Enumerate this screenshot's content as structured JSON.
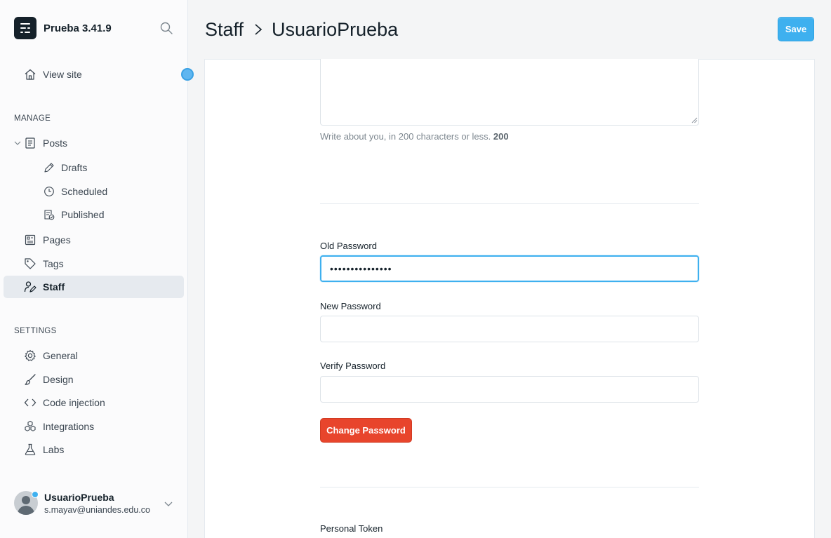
{
  "brand": {
    "title": "Prueba 3.41.9"
  },
  "sidebar": {
    "view_site": "View site",
    "manage_label": "MANAGE",
    "posts": "Posts",
    "drafts": "Drafts",
    "scheduled": "Scheduled",
    "published": "Published",
    "pages": "Pages",
    "tags": "Tags",
    "staff": "Staff",
    "settings_label": "SETTINGS",
    "general": "General",
    "design": "Design",
    "code_injection": "Code injection",
    "integrations": "Integrations",
    "labs": "Labs"
  },
  "user": {
    "name": "UsuarioPrueba",
    "email": "s.mayav@uniandes.edu.co"
  },
  "header": {
    "crumb_parent": "Staff",
    "crumb_current": "UsuarioPrueba",
    "save_label": "Save"
  },
  "bio": {
    "help_text": "Write about you, in 200 characters or less.",
    "char_count": "200"
  },
  "password": {
    "old_label": "Old Password",
    "old_value": "•••••••••••••••",
    "new_label": "New Password",
    "new_value": "",
    "verify_label": "Verify Password",
    "verify_value": "",
    "change_label": "Change Password"
  },
  "token": {
    "label": "Personal Token"
  },
  "colors": {
    "accent_blue": "#3eb0ef",
    "danger_red": "#e8452c",
    "sidebar_active": "#e6eaef"
  }
}
